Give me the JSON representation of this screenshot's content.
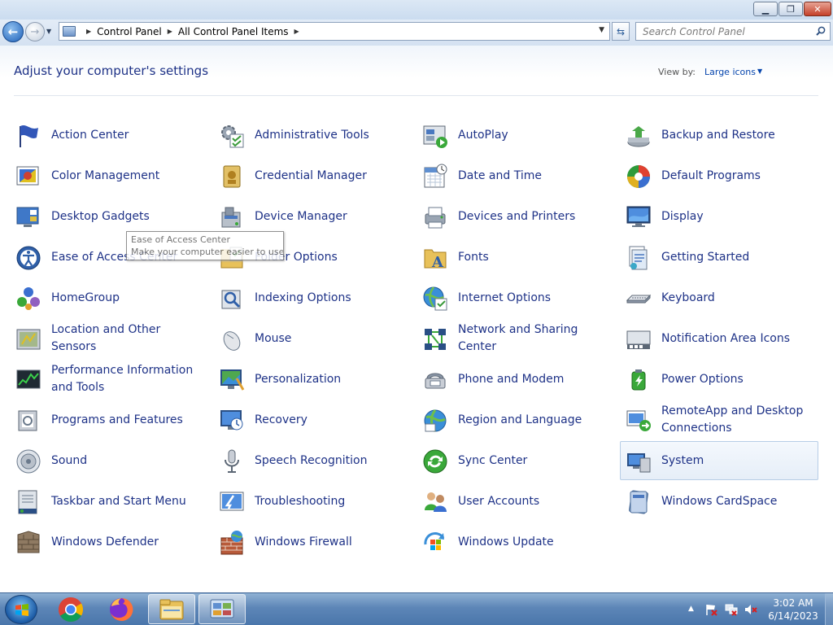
{
  "window": {
    "minimize_glyph": "▁",
    "maximize_glyph": "❐",
    "close_glyph": "✕"
  },
  "nav": {
    "back_glyph": "←",
    "forward_glyph": "→",
    "breadcrumbs": [
      "Control Panel",
      "All Control Panel Items"
    ],
    "search_placeholder": "Search Control Panel"
  },
  "header": {
    "title": "Adjust your computer's settings",
    "view_by_label": "View by:",
    "view_by_value": "Large icons"
  },
  "items": [
    {
      "label": "Action Center",
      "icon": "flag-icon"
    },
    {
      "label": "Administrative Tools",
      "icon": "admin-tools-icon"
    },
    {
      "label": "AutoPlay",
      "icon": "autoplay-icon"
    },
    {
      "label": "Backup and Restore",
      "icon": "backup-icon"
    },
    {
      "label": "Color Management",
      "icon": "color-management-icon"
    },
    {
      "label": "Credential Manager",
      "icon": "credential-icon"
    },
    {
      "label": "Date and Time",
      "icon": "calendar-clock-icon"
    },
    {
      "label": "Default Programs",
      "icon": "default-programs-icon"
    },
    {
      "label": "Desktop Gadgets",
      "icon": "gadgets-icon"
    },
    {
      "label": "Device Manager",
      "icon": "device-manager-icon"
    },
    {
      "label": "Devices and Printers",
      "icon": "printer-icon"
    },
    {
      "label": "Display",
      "icon": "display-icon"
    },
    {
      "label": "Ease of Access Center",
      "icon": "ease-of-access-icon"
    },
    {
      "label": "Folder Options",
      "icon": "folder-options-icon"
    },
    {
      "label": "Fonts",
      "icon": "fonts-folder-icon"
    },
    {
      "label": "Getting Started",
      "icon": "getting-started-icon"
    },
    {
      "label": "HomeGroup",
      "icon": "homegroup-icon"
    },
    {
      "label": "Indexing Options",
      "icon": "indexing-icon"
    },
    {
      "label": "Internet Options",
      "icon": "internet-options-icon"
    },
    {
      "label": "Keyboard",
      "icon": "keyboard-icon"
    },
    {
      "label": "Location and Other Sensors",
      "icon": "sensors-icon"
    },
    {
      "label": "Mouse",
      "icon": "mouse-icon"
    },
    {
      "label": "Network and Sharing Center",
      "icon": "network-icon"
    },
    {
      "label": "Notification Area Icons",
      "icon": "notification-icon"
    },
    {
      "label": "Performance Information and Tools",
      "icon": "performance-icon"
    },
    {
      "label": "Personalization",
      "icon": "personalization-icon"
    },
    {
      "label": "Phone and Modem",
      "icon": "phone-modem-icon"
    },
    {
      "label": "Power Options",
      "icon": "power-icon"
    },
    {
      "label": "Programs and Features",
      "icon": "programs-icon"
    },
    {
      "label": "Recovery",
      "icon": "recovery-icon"
    },
    {
      "label": "Region and Language",
      "icon": "region-globe-icon"
    },
    {
      "label": "RemoteApp and Desktop Connections",
      "icon": "remoteapp-icon"
    },
    {
      "label": "Sound",
      "icon": "speaker-icon"
    },
    {
      "label": "Speech Recognition",
      "icon": "microphone-icon"
    },
    {
      "label": "Sync Center",
      "icon": "sync-icon"
    },
    {
      "label": "System",
      "icon": "system-icon",
      "selected": true
    },
    {
      "label": "Taskbar and Start Menu",
      "icon": "taskbar-icon"
    },
    {
      "label": "Troubleshooting",
      "icon": "troubleshooting-icon"
    },
    {
      "label": "User Accounts",
      "icon": "users-icon"
    },
    {
      "label": "Windows CardSpace",
      "icon": "cardspace-icon"
    },
    {
      "label": "Windows Defender",
      "icon": "defender-icon"
    },
    {
      "label": "Windows Firewall",
      "icon": "firewall-icon"
    },
    {
      "label": "Windows Update",
      "icon": "update-icon"
    }
  ],
  "tooltip": {
    "title": "Ease of Access Center",
    "text": "Make your computer easier to use."
  },
  "taskbar": {
    "apps": [
      "chrome-icon",
      "firefox-icon",
      "explorer-icon",
      "control-panel-icon"
    ],
    "time": "3:02 AM",
    "date": "6/14/2023"
  }
}
